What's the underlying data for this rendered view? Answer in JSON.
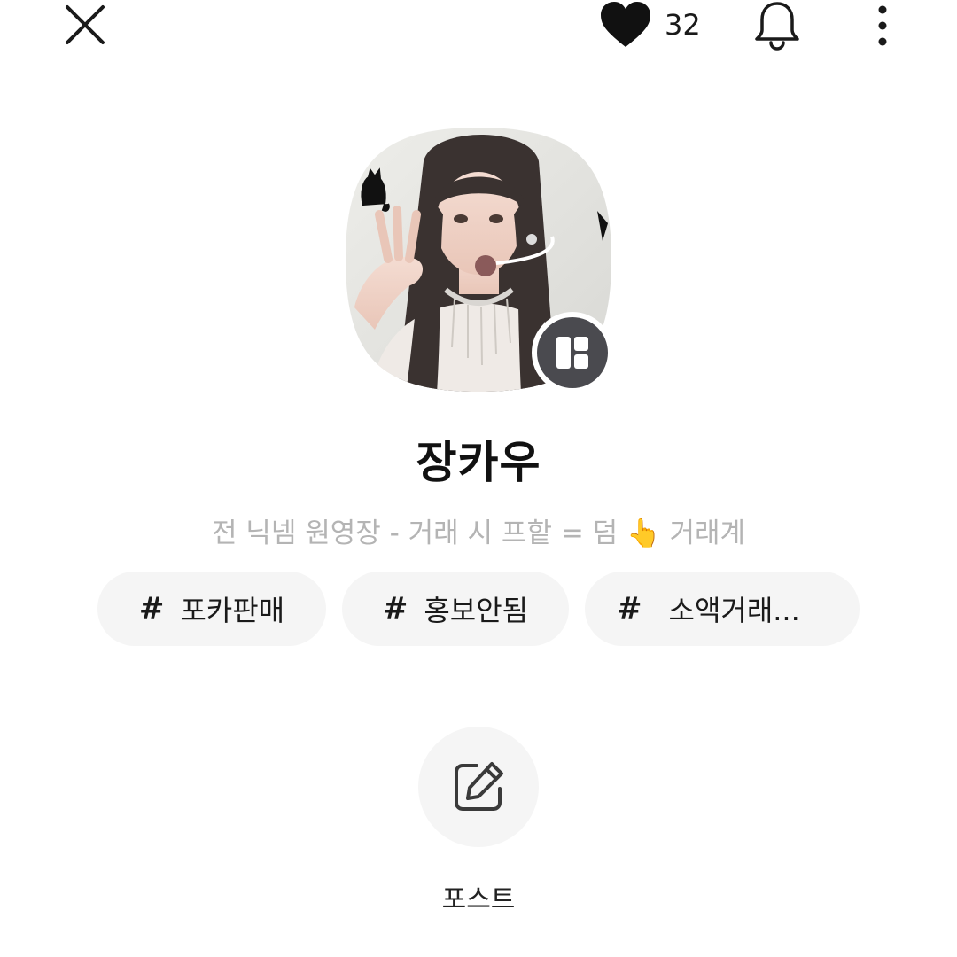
{
  "header": {
    "close_icon": "close-icon",
    "like_icon": "heart-icon",
    "like_count": "32",
    "bell_icon": "bell-icon",
    "more_icon": "more-vertical-icon"
  },
  "profile": {
    "avatar_description": "profile-photo",
    "badge_icon": "shop-badge-icon",
    "name": "장카우",
    "bio": "전 닉넴 원영장 - 거래 시 프핱 = 덤 👆 거래계"
  },
  "tags": [
    {
      "hash": "#",
      "label": "포카판매"
    },
    {
      "hash": "#",
      "label": "홍보안됨"
    },
    {
      "hash": "#",
      "label": "소액거래..."
    }
  ],
  "post": {
    "icon": "edit-icon",
    "label": "포스트"
  },
  "colors": {
    "text_primary": "#111111",
    "text_secondary": "#b4b4b4",
    "chip_bg": "#f5f5f5",
    "badge_bg": "#4a4a4f"
  }
}
